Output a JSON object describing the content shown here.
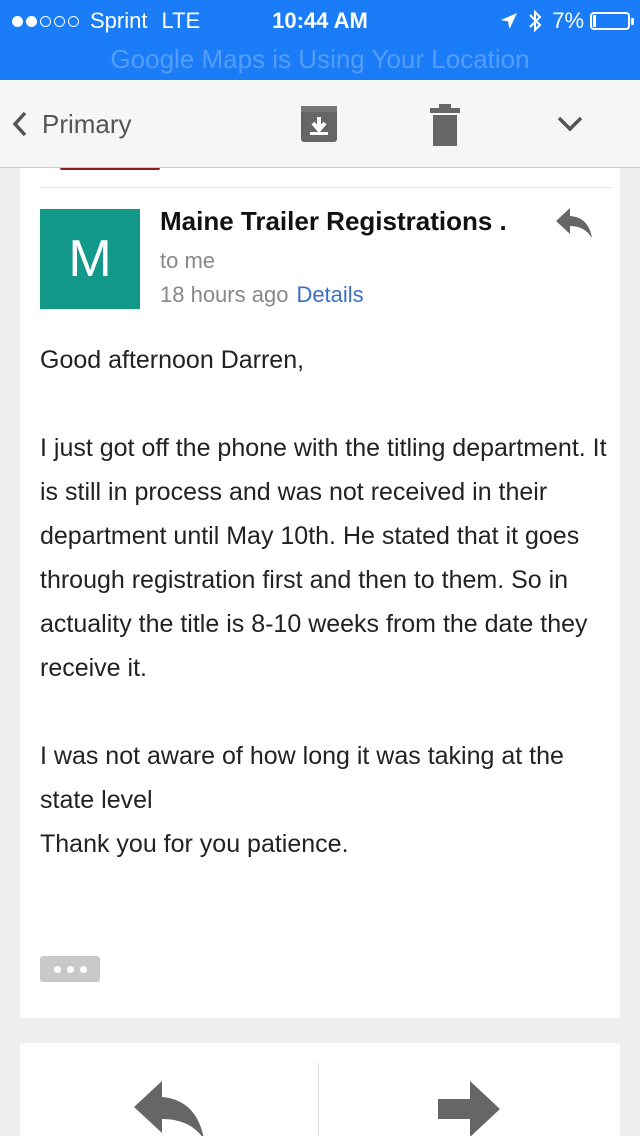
{
  "status_bar": {
    "carrier": "Sprint",
    "network": "LTE",
    "time": "10:44 AM",
    "battery_text": "7%",
    "battery_level": 0.07,
    "signal_bars_filled": 2,
    "signal_bars_total": 5
  },
  "location_banner": "Google Maps is Using Your Location",
  "toolbar": {
    "back_label": "Primary"
  },
  "message": {
    "avatar_letter": "M",
    "avatar_color": "#13998a",
    "sender": "Maine Trailer Registrations .",
    "recipient": "to me",
    "time_ago": "18 hours ago",
    "details_label": "Details",
    "body": [
      "Good afternoon Darren,",
      "I just got off the phone with the titling department. It is still in process and was not received in their department until May 10th. He stated that it goes through registration first and then to them. So in actuality the title is 8-10 weeks from the date they receive it.",
      "I was not aware of how long it was taking at the state level",
      "Thank you for you patience."
    ]
  },
  "colors": {
    "status_bar": "#1a7cf7",
    "link": "#3b6fc6",
    "accent_strip": "#8a1c24"
  }
}
